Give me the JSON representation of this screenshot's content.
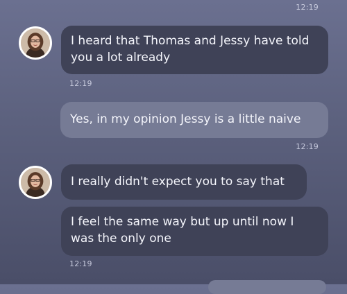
{
  "conversation": {
    "messages": [
      {
        "time": "12:19"
      },
      {
        "text": "I heard that Thomas and Jessy have told you a lot already",
        "time": "12:19"
      },
      {
        "text": "Yes, in my opinion Jessy is a little naive",
        "time": "12:19"
      },
      {
        "text": "I really didn't expect you to say that"
      },
      {
        "text": "I feel the same way but up until now I was the only one",
        "time": "12:19"
      }
    ]
  },
  "colors": {
    "incoming_bubble": "#3f4257",
    "outgoing_bubble": "#767b95",
    "background_top": "#6b7090",
    "background_bottom": "#4a4e68",
    "timestamp": "#c6c9dc"
  },
  "icons": {
    "avatar": "profile-photo"
  }
}
